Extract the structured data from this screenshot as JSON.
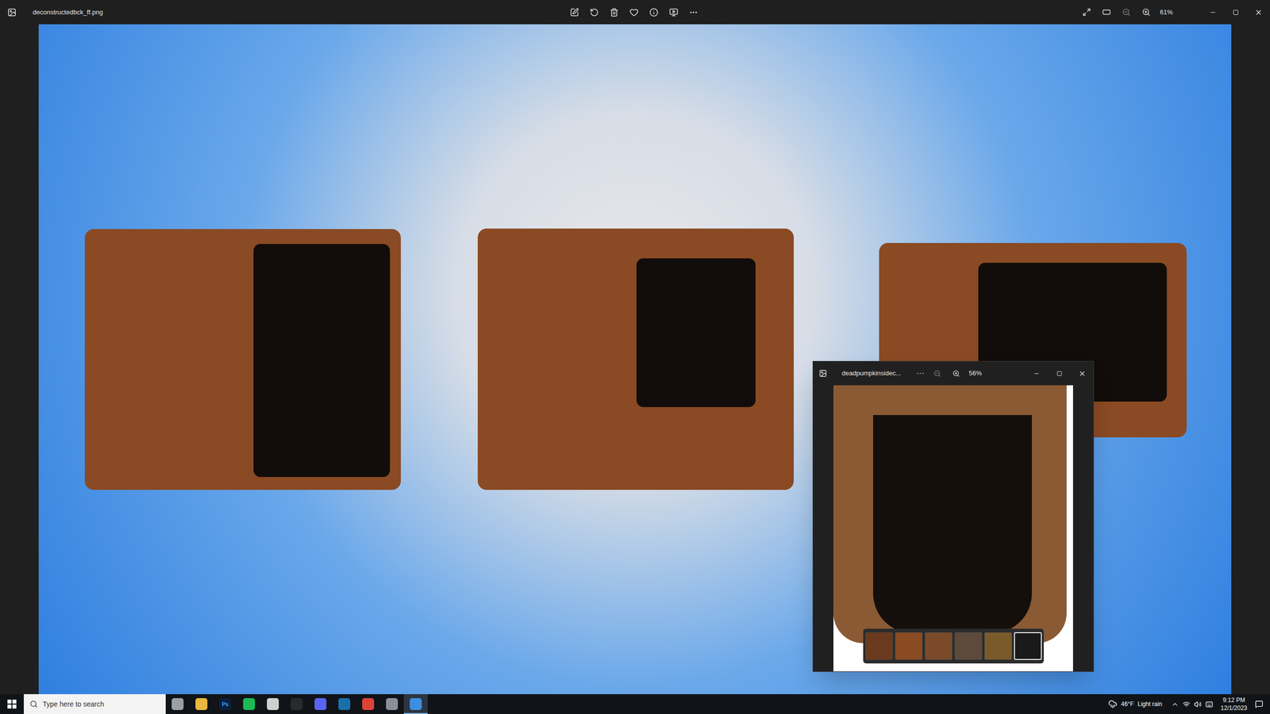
{
  "window": {
    "title": "deconstructedbck_ff.png",
    "zoom": "61%",
    "favorite": false
  },
  "viewer2": {
    "title": "deadpumpkinsidec...",
    "more": "···",
    "zoom": "56%",
    "filmstrip": [
      {
        "selected": false,
        "color": "#6b3a1e"
      },
      {
        "selected": false,
        "color": "#8a4a22"
      },
      {
        "selected": false,
        "color": "#7a4a2a"
      },
      {
        "selected": false,
        "color": "#5e4a3a"
      },
      {
        "selected": false,
        "color": "#7b5a2a"
      },
      {
        "selected": true,
        "color": "#1a1a1a"
      }
    ]
  },
  "taskbar": {
    "search": {
      "placeholder": "Type here to search"
    },
    "apps": [
      {
        "label": "",
        "color": "#9aa0a6",
        "active": false
      },
      {
        "label": "",
        "color": "#e8b840",
        "active": false
      },
      {
        "label": "Ps",
        "color": "#0b1e3a",
        "active": false
      },
      {
        "label": "",
        "color": "#1db954",
        "active": false
      },
      {
        "label": "",
        "color": "#d0d0d0",
        "active": false
      },
      {
        "label": "",
        "color": "#2a2a2a",
        "active": false
      },
      {
        "label": "",
        "color": "#5865f2",
        "active": false
      },
      {
        "label": "",
        "color": "#1b6fa8",
        "active": false
      },
      {
        "label": "",
        "color": "#db4437",
        "active": false
      },
      {
        "label": "",
        "color": "#8a8f98",
        "active": false
      },
      {
        "label": "",
        "color": "#3b8fe0",
        "active": true
      }
    ]
  },
  "weather": {
    "temp": "46°F",
    "condition": "Light rain"
  },
  "clock": {
    "time": "9:12 PM",
    "date": "12/1/2023"
  }
}
